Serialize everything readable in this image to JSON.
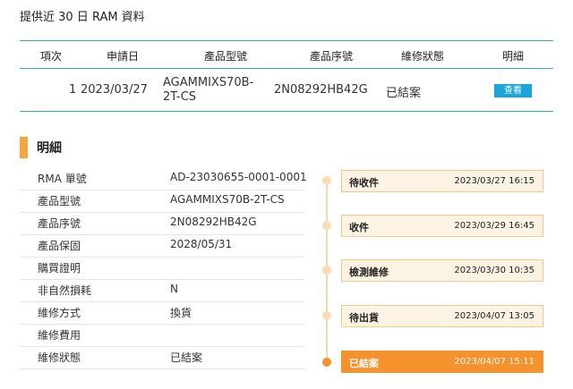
{
  "page": {
    "title": "提供近 30 日 RAM 資料"
  },
  "table": {
    "headers": [
      "項次",
      "申請日",
      "產品型號",
      "產品序號",
      "維修狀態",
      "明細"
    ],
    "rows": [
      {
        "index": "1",
        "apply_date": "2023/03/27",
        "model_line1": "AGAMMIXS70B-",
        "model_line2": "2T-CS",
        "serial": "2N08292HB42G",
        "status": "已結案",
        "action": "查看"
      }
    ]
  },
  "details": {
    "title": "明細",
    "rows": [
      {
        "label": "RMA 單號",
        "value": "AD-23030655-0001-0001"
      },
      {
        "label": "產品型號",
        "value": "AGAMMIXS70B-2T-CS"
      },
      {
        "label": "產品序號",
        "value": "2N08292HB42G"
      },
      {
        "label": "產品保固",
        "value": "2028/05/31"
      },
      {
        "label": "購買證明",
        "value": ""
      },
      {
        "label": "非自然損耗",
        "value": "N"
      },
      {
        "label": "維修方式",
        "value": "換貨"
      },
      {
        "label": "維修費用",
        "value": ""
      },
      {
        "label": "維修狀態",
        "value": "已結案"
      }
    ]
  },
  "timeline": [
    {
      "status": "待收件",
      "time": "2023/03/27 16:15"
    },
    {
      "status": "收件",
      "time": "2023/03/29 16:45"
    },
    {
      "status": "檢測維修",
      "time": "2023/03/30 10:35"
    },
    {
      "status": "待出貨",
      "time": "2023/04/07 13:05"
    },
    {
      "status": "已結案",
      "time": "2023/04/07 15:11",
      "active": true
    }
  ],
  "colors": {
    "accent": "#f5922b",
    "table_border": "#3aa9c9",
    "button": "#1aa6d9"
  }
}
